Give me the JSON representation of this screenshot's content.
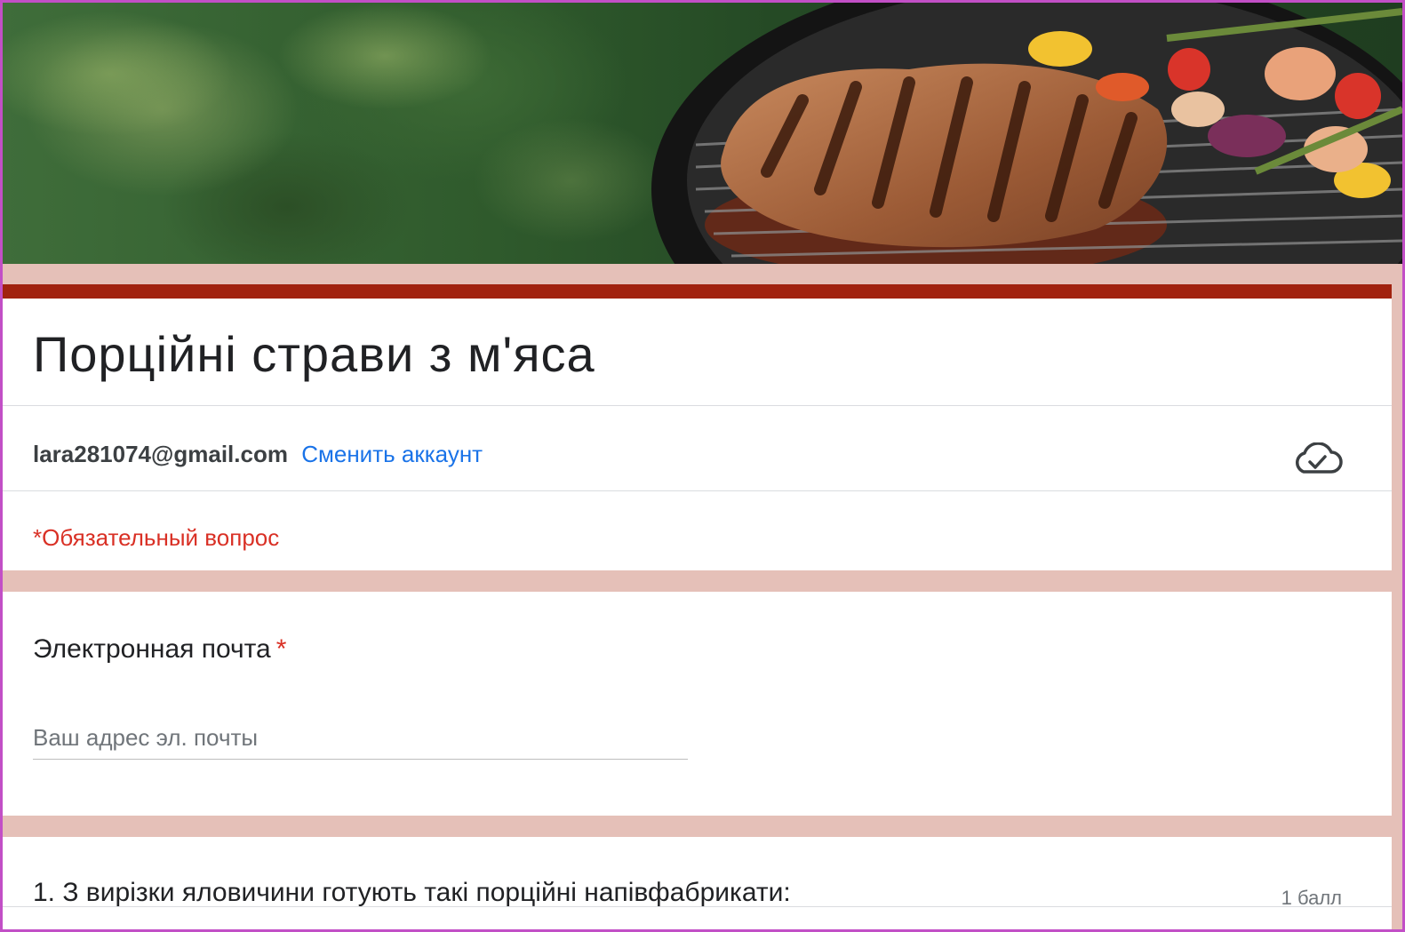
{
  "form": {
    "title": "Порційні страви з м'яса",
    "accent_color": "#a1220f",
    "background_color": "#e5c0b8"
  },
  "account": {
    "email": "lara281074@gmail.com",
    "switch_label": "Сменить аккаунт",
    "saved_icon": "cloud-check-icon"
  },
  "required_note": "*Обязательный вопрос",
  "email_question": {
    "label": "Электронная почта",
    "required_mark": "*",
    "placeholder": "Ваш адрес эл. почты"
  },
  "questions": [
    {
      "text": "1. З вирізки яловичини готують такі порційні напівфабрикати:",
      "points": "1 балл"
    }
  ]
}
